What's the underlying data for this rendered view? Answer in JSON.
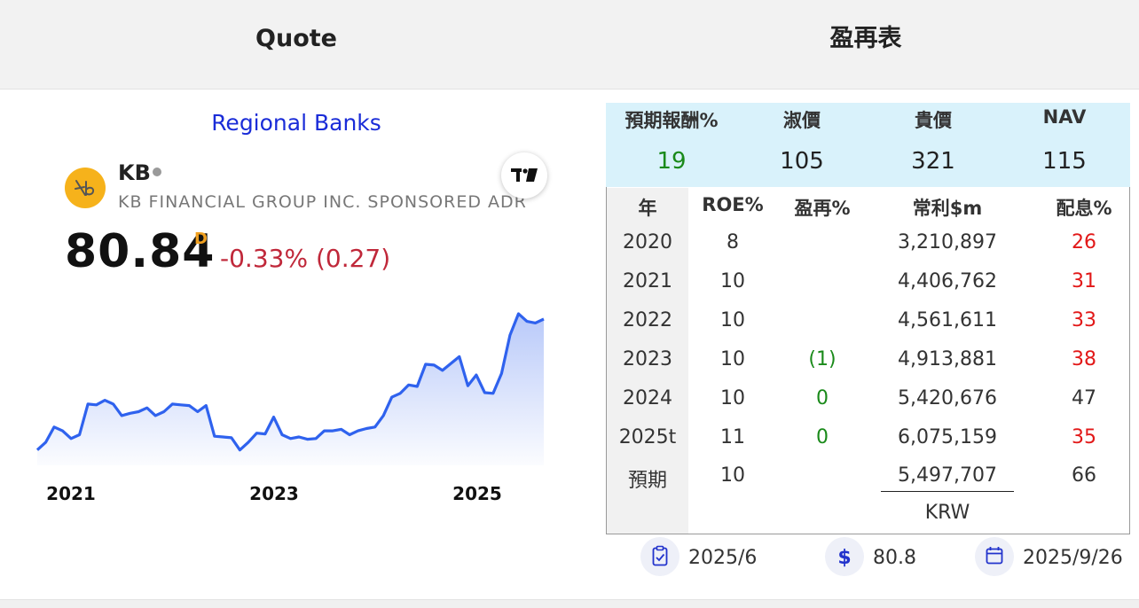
{
  "tabs": [
    "Quote",
    "盈再表"
  ],
  "quote": {
    "sector": "Regional Banks",
    "ticker": "KB",
    "company": "KB FINANCIAL GROUP INC. SPONSORED ADR",
    "price": "80.84",
    "price_flag": "D",
    "change": "-0.33% (0.27)",
    "logo_icon": "kb-logo-icon",
    "chart_icon": "tradingview-icon",
    "colors": {
      "up_line": "#2f62ee",
      "down_text": "#c0283a",
      "sector_link": "#1a2cd8"
    }
  },
  "chart_data": {
    "type": "area",
    "x_ticks": [
      "2021",
      "2023",
      "2025"
    ],
    "values": [
      56,
      57,
      59,
      58.5,
      57.5,
      58,
      62,
      61.9,
      62.5,
      62,
      60.5,
      60.8,
      61,
      61.5,
      60.5,
      61,
      62,
      61.9,
      61.8,
      61,
      61.8,
      57.8,
      57.7,
      57.6,
      56,
      57,
      58.2,
      58.1,
      60.3,
      58,
      57.5,
      57.7,
      57.4,
      57.5,
      58.5,
      58.5,
      58.7,
      58,
      58.5,
      58.8,
      59,
      60.5,
      62.9,
      63.4,
      64.5,
      64.3,
      67.2,
      67.1,
      66.4,
      67.3,
      68.2,
      64.4,
      65.8,
      63.5,
      63.4,
      66,
      71,
      73.8,
      72.8,
      72.6,
      73.1
    ],
    "ylim": [
      54,
      76
    ],
    "grid": false
  },
  "valuation": {
    "headers": [
      "預期報酬%",
      "淑價",
      "貴價",
      "NAV"
    ],
    "values": [
      "19",
      "105",
      "321",
      "115"
    ]
  },
  "table": {
    "headers": [
      "年",
      "ROE%",
      "盈再%",
      "常利$m",
      "配息%"
    ],
    "rows": [
      {
        "year": "2020",
        "roe": "8",
        "reinvest": "",
        "profit": "3,210,897",
        "payout": "26"
      },
      {
        "year": "2021",
        "roe": "10",
        "reinvest": "",
        "profit": "4,406,762",
        "payout": "31"
      },
      {
        "year": "2022",
        "roe": "10",
        "reinvest": "",
        "profit": "4,561,611",
        "payout": "33"
      },
      {
        "year": "2023",
        "roe": "10",
        "reinvest": "(1)",
        "profit": "4,913,881",
        "payout": "38"
      },
      {
        "year": "2024",
        "roe": "10",
        "reinvest": "0",
        "profit": "5,420,676",
        "payout": "47"
      },
      {
        "year": "2025t",
        "roe": "11",
        "reinvest": "0",
        "profit": "6,075,159",
        "payout": "35"
      },
      {
        "year": "預期",
        "roe": "10",
        "reinvest": "",
        "profit": "5,497,707",
        "payout": "66"
      }
    ],
    "currency": "KRW"
  },
  "footer": {
    "report_date": "2025/6",
    "price": "80.8",
    "update_date": "2025/9/26",
    "icons": [
      "report-check-icon",
      "dollar-icon",
      "calendar-icon"
    ]
  }
}
